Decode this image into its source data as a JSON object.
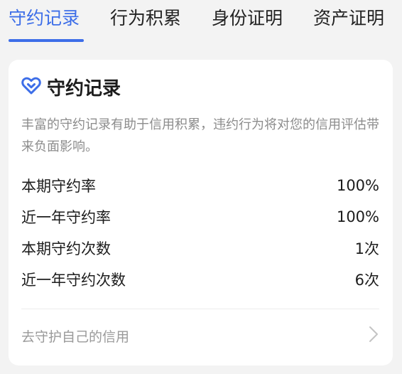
{
  "tabs": [
    {
      "label": "守约记录",
      "active": true
    },
    {
      "label": "行为积累",
      "active": false
    },
    {
      "label": "身份证明",
      "active": false
    },
    {
      "label": "资产证明",
      "active": false
    }
  ],
  "colors": {
    "accent": "#3d6ee8",
    "muted_text": "#8c8c8c",
    "background": "#f3f3f3",
    "card": "#ffffff"
  },
  "card": {
    "icon": "heart-shield-icon",
    "title": "守约记录",
    "description": "丰富的守约记录有助于信用积累，违约行为将对您的信用评估带来负面影响。",
    "stats": [
      {
        "label": "本期守约率",
        "value": "100%"
      },
      {
        "label": "近一年守约率",
        "value": "100%"
      },
      {
        "label": "本期守约次数",
        "value": "1次"
      },
      {
        "label": "近一年守约次数",
        "value": "6次"
      }
    ],
    "footer_link": {
      "label": "去守护自己的信用",
      "icon": "chevron-right-icon"
    }
  }
}
